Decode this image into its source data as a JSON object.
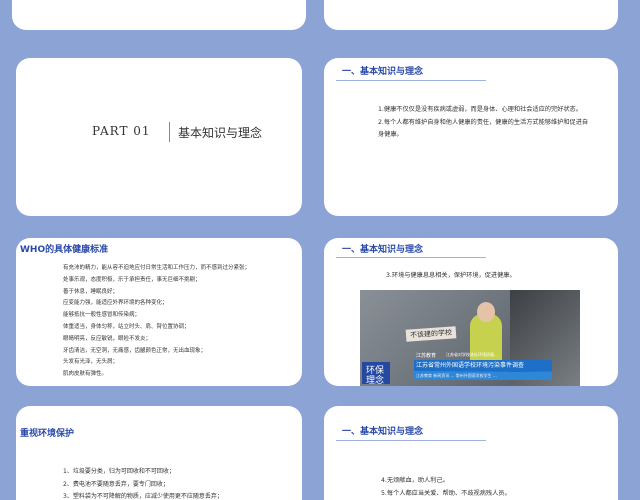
{
  "slides": {
    "s5": {
      "part": "PART 01",
      "title": "基本知识与理念"
    },
    "s6": {
      "heading": "一、基本知识与理念",
      "body": "1.健康不仅仅是没有疾病或虚弱，而是身体、心理和社会适应的完好状态。\n2.每个人都有维护自身和他人健康的责任，健康的生活方式能够维护和促进自\n身健康。"
    },
    "s7": {
      "heading": "WHO的具体健康标准",
      "body": "有充沛的精力，能从容不迫地应付日常生活和工作压力，而不感到过分紧张；\n处事乐观，态度积极，乐于承担责任，事无巨细不挑剔；\n善于休息，睡眠良好；\n应变能力强，能适应外界环境的各种变化；\n能够抵抗一般性感冒和传染病；\n体重适当，身体匀称，站立时头、肩、臂位置协调；\n眼睛明亮，反应敏锐，眼睑不发炎；\n牙齿清洁，无空洞，无痛感，齿龈颜色正常，无出血现象；\n头发有光泽，无头屑；\n肌肉皮肤有弹性。"
    },
    "s8": {
      "heading": "一、基本知识与理念",
      "body": "3.环境与健康息息相关，保护环境，促进健康。",
      "image": {
        "sign_text": "不该建的学校",
        "channel_text": "江苏教育",
        "caption_small": "江苏省对学校选址环境质量...",
        "caption_main": "江苏省常州外国语学校环境污染事件调查",
        "ticker": "江苏教育 新闻资讯 ... 常州外国语学校学生 ...",
        "badge_line1": "环保",
        "badge_line2": "理念"
      }
    },
    "s9": {
      "heading": "重视环境保护",
      "body": "1、垃圾要分类，归为可回收和不可回收；\n2、费电池不要随意丢弃，要专门回收；\n3、塑料袋为不可降解的物质，应减少使用更不应随意丢弃；"
    },
    "s10": {
      "heading": "一、基本知识与理念",
      "body": "4.无烦献血，助人利己。\n5.每个人都应当关爱、帮助、不歧视病残人员。"
    }
  }
}
